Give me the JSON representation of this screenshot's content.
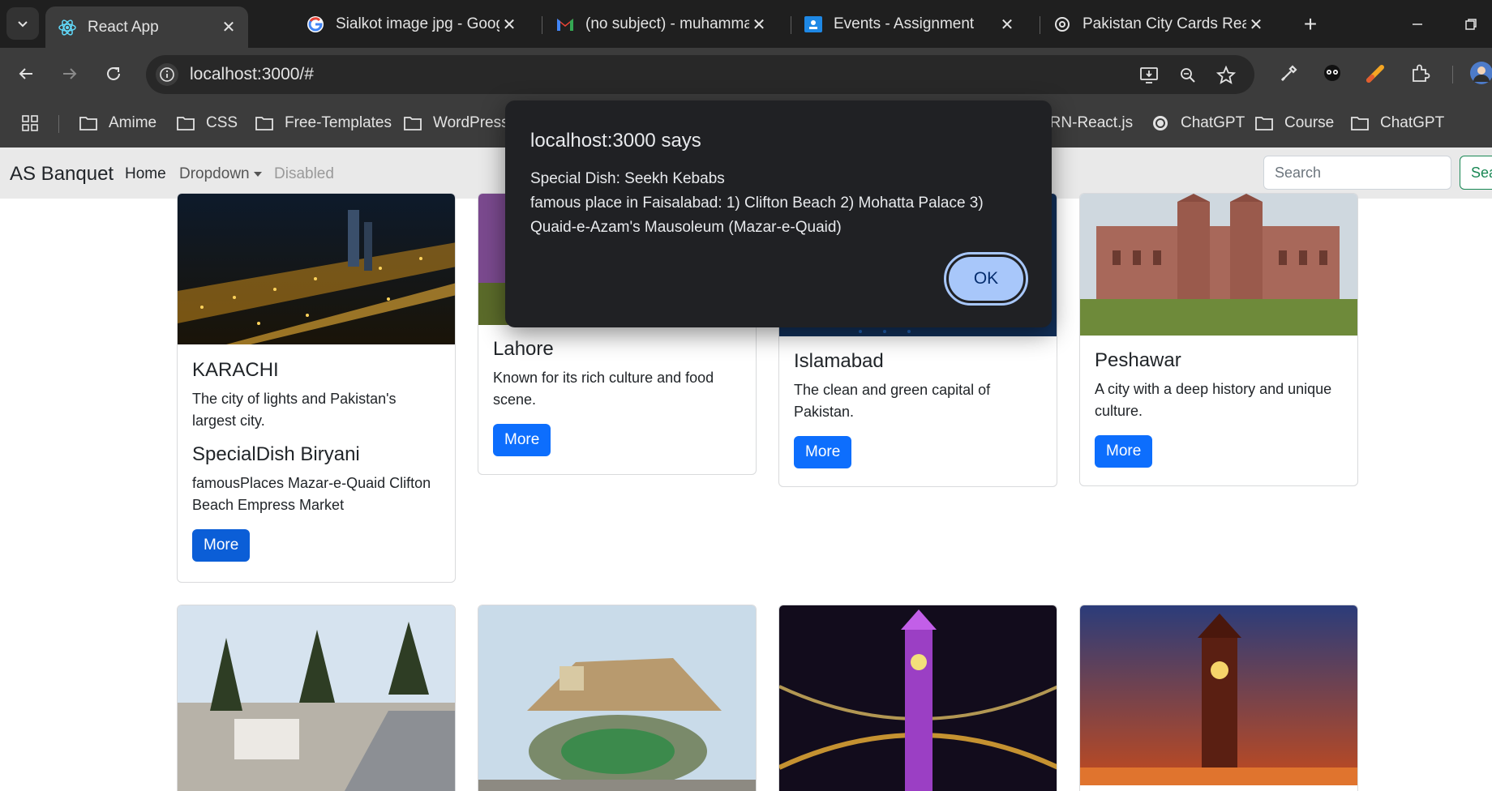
{
  "browser": {
    "tabs": [
      {
        "label": "React App",
        "icon": "react-icon",
        "active": true
      },
      {
        "label": "Sialkot image jpg - Goog",
        "icon": "google-icon",
        "active": false
      },
      {
        "label": "(no subject) - muhamma",
        "icon": "gmail-icon",
        "active": false
      },
      {
        "label": "Events - Assignment",
        "icon": "classroom-icon",
        "active": false
      },
      {
        "label": "Pakistan City Cards React",
        "icon": "chatgpt-icon",
        "active": false
      }
    ],
    "url": "localhost:3000/#",
    "bookmarks": [
      {
        "label": "Amime",
        "icon": "folder-icon"
      },
      {
        "label": "CSS",
        "icon": "folder-icon"
      },
      {
        "label": "Free-Templates",
        "icon": "folder-icon"
      },
      {
        "label": "WordPress",
        "icon": "folder-icon"
      },
      {
        "label": "ARN-React.js",
        "icon": "folder-icon"
      },
      {
        "label": "ChatGPT",
        "icon": "chatgpt-icon"
      },
      {
        "label": "Course",
        "icon": "folder-icon"
      },
      {
        "label": "ChatGPT",
        "icon": "folder-icon"
      }
    ]
  },
  "navbar": {
    "brand": "AS Banquet",
    "links": [
      "Home",
      "Dropdown",
      "Disabled"
    ],
    "search_placeholder": "Search",
    "search_button": "Sea"
  },
  "cards_row1": [
    {
      "title": "KARACHI",
      "text": "The city of lights and Pakistan's largest city.",
      "dish": "SpecialDish Biryani",
      "places": "famousPlaces Mazar-e-Quaid Clifton Beach Empress Market",
      "button": "More"
    },
    {
      "title": "Lahore",
      "text": "Known for its rich culture and food scene.",
      "button": "More"
    },
    {
      "title": "Islamabad",
      "text": "The clean and green capital of Pakistan.",
      "button": "More"
    },
    {
      "title": "Peshawar",
      "text": "A city with a deep history and unique culture.",
      "button": "More"
    }
  ],
  "dialog": {
    "title": "localhost:3000 says",
    "lines": [
      "Special Dish: Seekh Kebabs",
      "famous place in Faisalabad: 1) Clifton Beach 2) Mohatta Palace 3)",
      "Quaid-e-Azam's Mausoleum (Mazar-e-Quaid)"
    ],
    "ok": "OK"
  },
  "colors": {
    "primary": "#0d6efd",
    "success": "#198754",
    "dialog_bg": "#202124",
    "ok_button": "#a8c7fa"
  }
}
